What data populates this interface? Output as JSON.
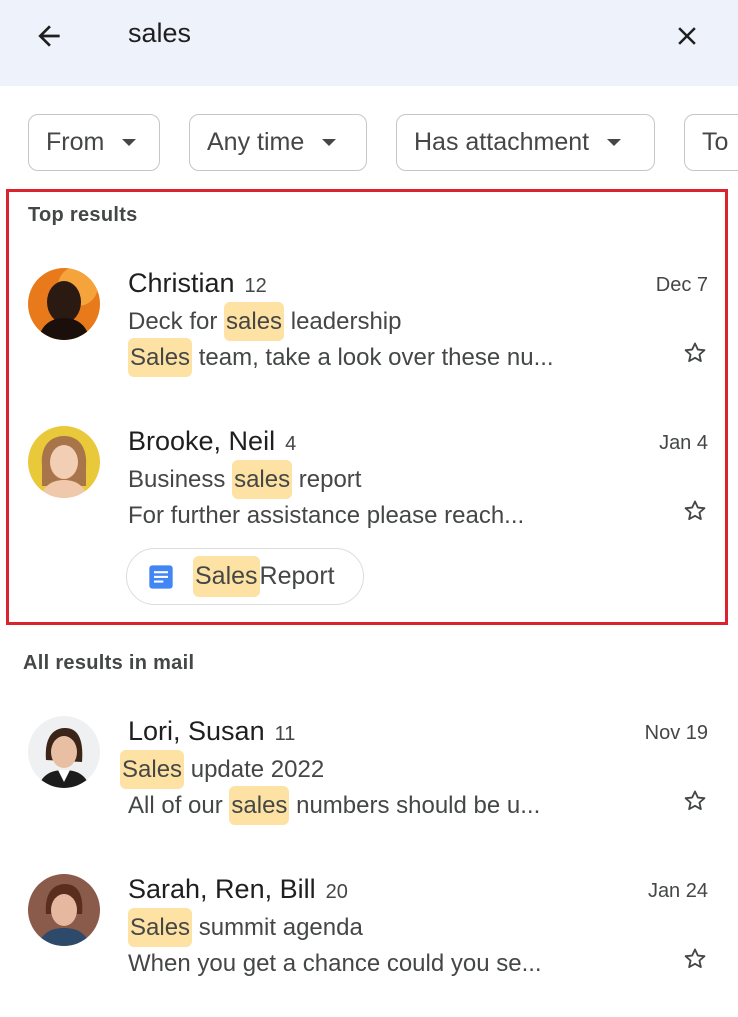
{
  "search": {
    "query": "sales"
  },
  "filters": [
    {
      "label": "From"
    },
    {
      "label": "Any time"
    },
    {
      "label": "Has attachment"
    },
    {
      "label": "To"
    }
  ],
  "top_results": {
    "title": "Top results",
    "items": [
      {
        "sender": "Christian",
        "count": "12",
        "date": "Dec 7",
        "subject_before": "Deck for ",
        "subject_hl": "sales",
        "subject_after": " leadership",
        "snippet_before": "",
        "snippet_hl": "Sales",
        "snippet_after": " team, take a look over these nu..."
      },
      {
        "sender": "Brooke, Neil",
        "count": "4",
        "date": "Jan 4",
        "subject_before": "Business ",
        "subject_hl": "sales",
        "subject_after": " report",
        "snippet_before": "For further assistance please reach...",
        "snippet_hl": "",
        "snippet_after": "",
        "attachment_hl": "Sales",
        "attachment_rest": " Report"
      }
    ]
  },
  "all_results": {
    "title": "All results in mail",
    "items": [
      {
        "sender": "Lori, Susan",
        "count": "11",
        "date": "Nov 19",
        "subject_before": "",
        "subject_hl": "Sales",
        "subject_after": " update 2022",
        "snippet_before": "All of our ",
        "snippet_hl": "sales",
        "snippet_after": " numbers should be u..."
      },
      {
        "sender": "Sarah, Ren, Bill",
        "count": "20",
        "date": "Jan 24",
        "subject_before": "",
        "subject_hl": "Sales",
        "subject_after": " summit agenda",
        "snippet_before": "When you get a chance could you se...",
        "snippet_hl": "",
        "snippet_after": ""
      }
    ]
  },
  "colors": {
    "search_bar_bg": "#eef2fa",
    "highlight": "#fde2a3",
    "focus_border": "#d9232e",
    "doc_icon": "#4285f4"
  },
  "icons": {
    "back": "arrow-left-icon",
    "close": "close-icon",
    "star": "star-outline-icon",
    "doc": "google-docs-icon"
  }
}
